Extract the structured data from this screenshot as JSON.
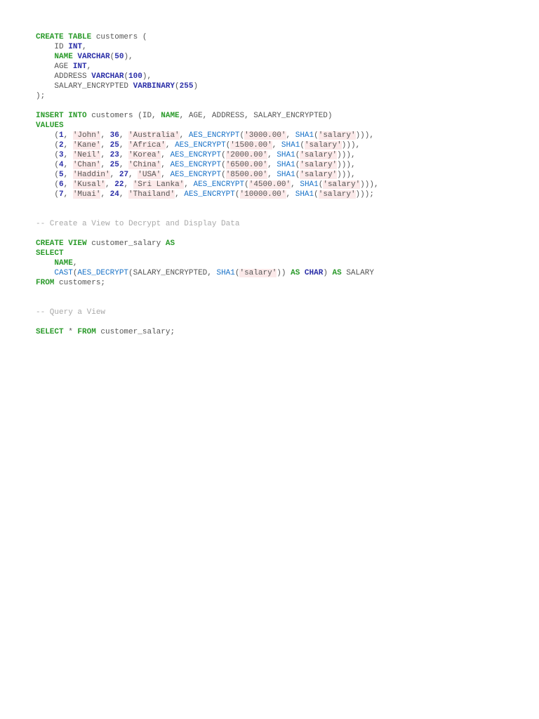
{
  "code_lines": [
    [
      [
        "k",
        "CREATE TABLE"
      ],
      [
        "p",
        " customers ("
      ]
    ],
    [
      [
        "p",
        "    ID "
      ],
      [
        "ty",
        "INT"
      ],
      [
        "p",
        ","
      ]
    ],
    [
      [
        "p",
        "    "
      ],
      [
        "k",
        "NAME"
      ],
      [
        "p",
        " "
      ],
      [
        "ty",
        "VARCHAR"
      ],
      [
        "p",
        "("
      ],
      [
        "n",
        "50"
      ],
      [
        "p",
        "),"
      ]
    ],
    [
      [
        "p",
        "    AGE "
      ],
      [
        "ty",
        "INT"
      ],
      [
        "p",
        ","
      ]
    ],
    [
      [
        "p",
        "    ADDRESS "
      ],
      [
        "ty",
        "VARCHAR"
      ],
      [
        "p",
        "("
      ],
      [
        "n",
        "100"
      ],
      [
        "p",
        "),"
      ]
    ],
    [
      [
        "p",
        "    SALARY_ENCRYPTED "
      ],
      [
        "ty",
        "VARBINARY"
      ],
      [
        "p",
        "("
      ],
      [
        "n",
        "255"
      ],
      [
        "p",
        ")"
      ]
    ],
    [
      [
        "p",
        ");"
      ]
    ],
    [],
    [
      [
        "k",
        "INSERT INTO"
      ],
      [
        "p",
        " customers (ID, "
      ],
      [
        "k",
        "NAME"
      ],
      [
        "p",
        ", AGE, ADDRESS, SALARY_ENCRYPTED)"
      ]
    ],
    [
      [
        "k",
        "VALUES"
      ]
    ],
    [
      [
        "p",
        "    ("
      ],
      [
        "n",
        "1"
      ],
      [
        "p",
        ", "
      ],
      [
        "s",
        "'John'"
      ],
      [
        "p",
        ", "
      ],
      [
        "n",
        "36"
      ],
      [
        "p",
        ", "
      ],
      [
        "s",
        "'Australia'"
      ],
      [
        "p",
        ", "
      ],
      [
        "f",
        "AES_ENCRYPT"
      ],
      [
        "p",
        "("
      ],
      [
        "s",
        "'3000.00'"
      ],
      [
        "p",
        ", "
      ],
      [
        "f",
        "SHA1"
      ],
      [
        "p",
        "("
      ],
      [
        "s",
        "'salary'"
      ],
      [
        "p",
        ")))"
      ],
      [
        "p",
        ","
      ]
    ],
    [
      [
        "p",
        "    ("
      ],
      [
        "n",
        "2"
      ],
      [
        "p",
        ", "
      ],
      [
        "s",
        "'Kane'"
      ],
      [
        "p",
        ", "
      ],
      [
        "n",
        "25"
      ],
      [
        "p",
        ", "
      ],
      [
        "s",
        "'Africa'"
      ],
      [
        "p",
        ", "
      ],
      [
        "f",
        "AES_ENCRYPT"
      ],
      [
        "p",
        "("
      ],
      [
        "s",
        "'1500.00'"
      ],
      [
        "p",
        ", "
      ],
      [
        "f",
        "SHA1"
      ],
      [
        "p",
        "("
      ],
      [
        "s",
        "'salary'"
      ],
      [
        "p",
        ")))"
      ],
      [
        "p",
        ","
      ]
    ],
    [
      [
        "p",
        "    ("
      ],
      [
        "n",
        "3"
      ],
      [
        "p",
        ", "
      ],
      [
        "s",
        "'Neil'"
      ],
      [
        "p",
        ", "
      ],
      [
        "n",
        "23"
      ],
      [
        "p",
        ", "
      ],
      [
        "s",
        "'Korea'"
      ],
      [
        "p",
        ", "
      ],
      [
        "f",
        "AES_ENCRYPT"
      ],
      [
        "p",
        "("
      ],
      [
        "s",
        "'2000.00'"
      ],
      [
        "p",
        ", "
      ],
      [
        "f",
        "SHA1"
      ],
      [
        "p",
        "("
      ],
      [
        "s",
        "'salary'"
      ],
      [
        "p",
        ")))"
      ],
      [
        "p",
        ","
      ]
    ],
    [
      [
        "p",
        "    ("
      ],
      [
        "n",
        "4"
      ],
      [
        "p",
        ", "
      ],
      [
        "s",
        "'Chan'"
      ],
      [
        "p",
        ", "
      ],
      [
        "n",
        "25"
      ],
      [
        "p",
        ", "
      ],
      [
        "s",
        "'China'"
      ],
      [
        "p",
        ", "
      ],
      [
        "f",
        "AES_ENCRYPT"
      ],
      [
        "p",
        "("
      ],
      [
        "s",
        "'6500.00'"
      ],
      [
        "p",
        ", "
      ],
      [
        "f",
        "SHA1"
      ],
      [
        "p",
        "("
      ],
      [
        "s",
        "'salary'"
      ],
      [
        "p",
        ")))"
      ],
      [
        "p",
        ","
      ]
    ],
    [
      [
        "p",
        "    ("
      ],
      [
        "n",
        "5"
      ],
      [
        "p",
        ", "
      ],
      [
        "s",
        "'Haddin'"
      ],
      [
        "p",
        ", "
      ],
      [
        "n",
        "27"
      ],
      [
        "p",
        ", "
      ],
      [
        "s",
        "'USA'"
      ],
      [
        "p",
        ", "
      ],
      [
        "f",
        "AES_ENCRYPT"
      ],
      [
        "p",
        "("
      ],
      [
        "s",
        "'8500.00'"
      ],
      [
        "p",
        ", "
      ],
      [
        "f",
        "SHA1"
      ],
      [
        "p",
        "("
      ],
      [
        "s",
        "'salary'"
      ],
      [
        "p",
        ")))"
      ],
      [
        "p",
        ","
      ]
    ],
    [
      [
        "p",
        "    ("
      ],
      [
        "n",
        "6"
      ],
      [
        "p",
        ", "
      ],
      [
        "s",
        "'Kusal'"
      ],
      [
        "p",
        ", "
      ],
      [
        "n",
        "22"
      ],
      [
        "p",
        ", "
      ],
      [
        "s",
        "'Sri Lanka'"
      ],
      [
        "p",
        ", "
      ],
      [
        "f",
        "AES_ENCRYPT"
      ],
      [
        "p",
        "("
      ],
      [
        "s",
        "'4500.00'"
      ],
      [
        "p",
        ", "
      ],
      [
        "f",
        "SHA1"
      ],
      [
        "p",
        "("
      ],
      [
        "s",
        "'salary'"
      ],
      [
        "p",
        ")))"
      ],
      [
        "p",
        ","
      ]
    ],
    [
      [
        "p",
        "    ("
      ],
      [
        "n",
        "7"
      ],
      [
        "p",
        ", "
      ],
      [
        "s",
        "'Muai'"
      ],
      [
        "p",
        ", "
      ],
      [
        "n",
        "24"
      ],
      [
        "p",
        ", "
      ],
      [
        "s",
        "'Thailand'"
      ],
      [
        "p",
        ", "
      ],
      [
        "f",
        "AES_ENCRYPT"
      ],
      [
        "p",
        "("
      ],
      [
        "s",
        "'10000.00'"
      ],
      [
        "p",
        ", "
      ],
      [
        "f",
        "SHA1"
      ],
      [
        "p",
        "("
      ],
      [
        "s",
        "'salary'"
      ],
      [
        "p",
        ")))"
      ],
      [
        "p",
        ";"
      ]
    ],
    [],
    [],
    [
      [
        "c",
        "-- Create a View to Decrypt and Display Data"
      ]
    ],
    [],
    [
      [
        "k",
        "CREATE VIEW"
      ],
      [
        "p",
        " customer_salary "
      ],
      [
        "k",
        "AS"
      ]
    ],
    [
      [
        "k",
        "SELECT"
      ]
    ],
    [
      [
        "p",
        "    "
      ],
      [
        "k",
        "NAME"
      ],
      [
        "p",
        ","
      ]
    ],
    [
      [
        "p",
        "    "
      ],
      [
        "f",
        "CAST"
      ],
      [
        "p",
        "("
      ],
      [
        "f",
        "AES_DECRYPT"
      ],
      [
        "p",
        "(SALARY_ENCRYPTED, "
      ],
      [
        "f",
        "SHA1"
      ],
      [
        "p",
        "("
      ],
      [
        "s",
        "'salary'"
      ],
      [
        "p",
        ")) "
      ],
      [
        "k",
        "AS"
      ],
      [
        "p",
        " "
      ],
      [
        "ty",
        "CHAR"
      ],
      [
        "p",
        ") "
      ],
      [
        "k",
        "AS"
      ],
      [
        "p",
        " SALARY"
      ]
    ],
    [
      [
        "k",
        "FROM"
      ],
      [
        "p",
        " customers;"
      ]
    ],
    [],
    [],
    [
      [
        "c",
        "-- Query a View"
      ]
    ],
    [],
    [
      [
        "k",
        "SELECT"
      ],
      [
        "p",
        " * "
      ],
      [
        "k",
        "FROM"
      ],
      [
        "p",
        " customer_salary;"
      ]
    ]
  ]
}
